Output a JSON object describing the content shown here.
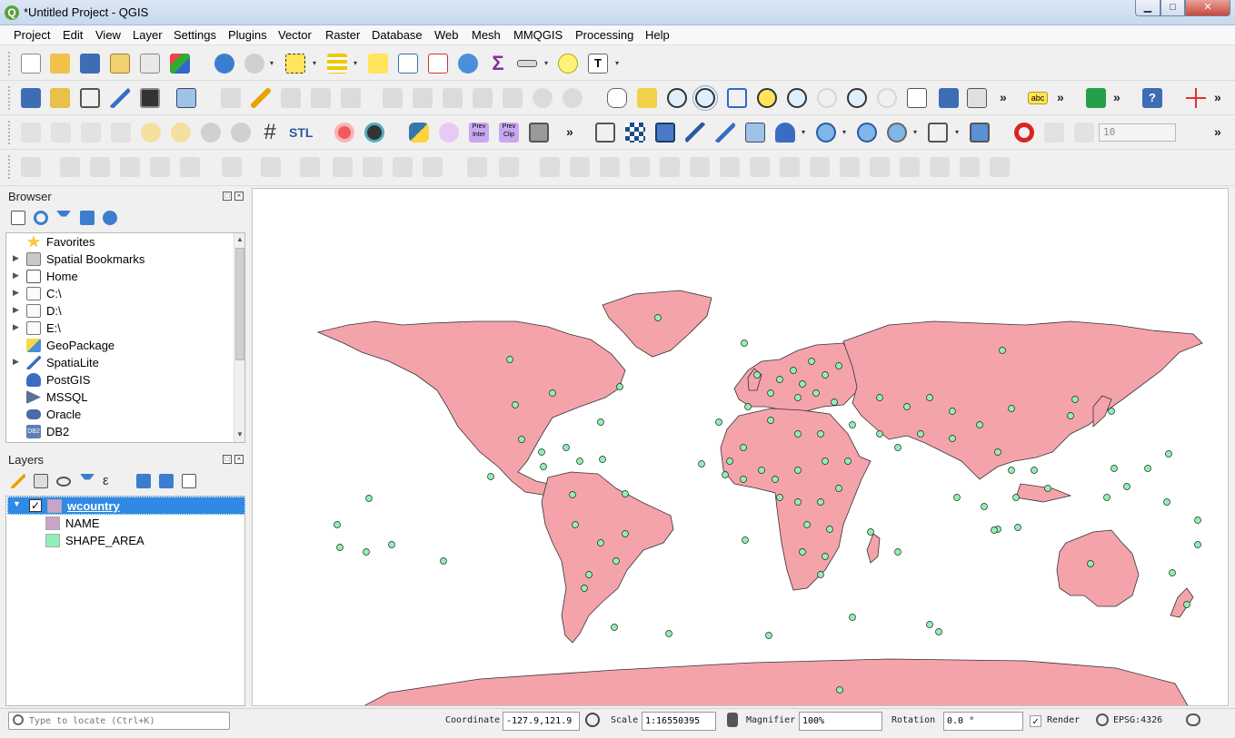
{
  "window": {
    "title": "*Untitled Project - QGIS",
    "app_icon": "Q"
  },
  "window_controls": {
    "minimize": "▁",
    "maximize": "□",
    "close": "✕"
  },
  "menu": [
    "Project",
    "Edit",
    "View",
    "Layer",
    "Settings",
    "Plugins",
    "Vector",
    "Raster",
    "Database",
    "Web",
    "Mesh",
    "MMQGIS",
    "Processing",
    "Help"
  ],
  "toolbar": {
    "more_glyph": "»",
    "dropdown_glyph": "▾",
    "snapping_tolerance": "10",
    "label_badge": "abc",
    "stl_label": "STL",
    "prev_inter_label": "Prev Inter",
    "prev_clip_label": "Prev Clip",
    "grid_glyph": "#",
    "text_glyph": "T"
  },
  "panels": {
    "browser": {
      "title": "Browser",
      "items": [
        {
          "label": "Favorites",
          "icon": "star-icon",
          "expandable": false
        },
        {
          "label": "Spatial Bookmarks",
          "icon": "bookmark-icon",
          "expandable": true
        },
        {
          "label": "Home",
          "icon": "home-icon",
          "expandable": true
        },
        {
          "label": "C:\\",
          "icon": "folder-icon",
          "expandable": true
        },
        {
          "label": "D:\\",
          "icon": "folder-icon",
          "expandable": true
        },
        {
          "label": "E:\\",
          "icon": "folder-icon",
          "expandable": true
        },
        {
          "label": "GeoPackage",
          "icon": "geopackage-icon",
          "expandable": false
        },
        {
          "label": "SpatiaLite",
          "icon": "spatialite-icon",
          "expandable": true
        },
        {
          "label": "PostGIS",
          "icon": "postgis-icon",
          "expandable": false
        },
        {
          "label": "MSSQL",
          "icon": "mssql-icon",
          "expandable": false
        },
        {
          "label": "Oracle",
          "icon": "oracle-icon",
          "expandable": false
        },
        {
          "label": "DB2",
          "icon": "db2-icon",
          "expandable": false
        }
      ]
    },
    "layers": {
      "title": "Layers",
      "layer": {
        "name": "wcountry",
        "checked": "✓",
        "swatch_color": "#c9a4c9"
      },
      "legend": [
        {
          "label": "NAME",
          "color": "#c9a4c9"
        },
        {
          "label": "SHAPE_AREA",
          "color": "#8ef0b4"
        }
      ]
    }
  },
  "map": {
    "land_color": "#f4a3ab",
    "point_color": "#8ef0b4",
    "outline_color": "#333333"
  },
  "status": {
    "locate_placeholder": "Type to locate (Ctrl+K)",
    "coordinate_label": "Coordinate",
    "coordinate_value": "-127.9,121.9",
    "scale_label": "Scale",
    "scale_value": "1:16550395",
    "magnifier_label": "Magnifier",
    "magnifier_value": "100%",
    "rotation_label": "Rotation",
    "rotation_value": "0.0 °",
    "render_label": "Render",
    "render_checked": "✓",
    "crs_label": "EPSG:4326"
  }
}
